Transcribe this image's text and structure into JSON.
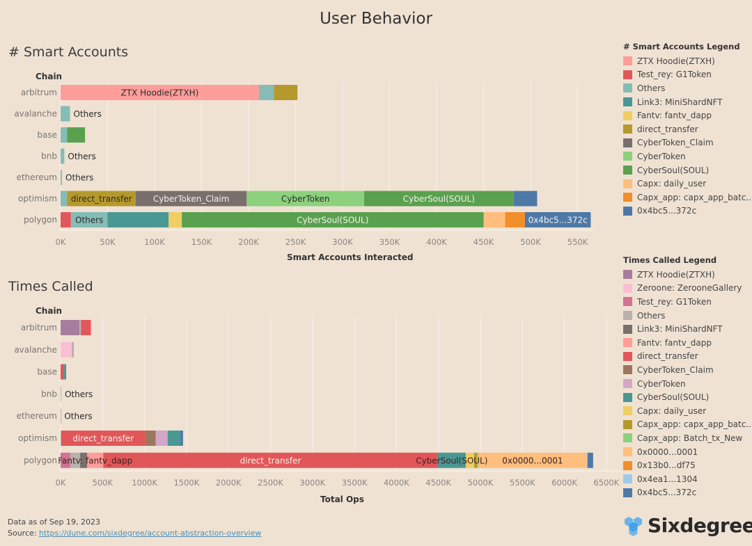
{
  "title": "User Behavior",
  "sections": {
    "smart_accounts_title": "# Smart Accounts",
    "times_called_title": "Times Called"
  },
  "chart_data": [
    {
      "type": "bar",
      "orientation": "horizontal-stacked",
      "title": "# Smart Accounts",
      "row_header": "Chain",
      "xlabel": "Smart Accounts Interacted",
      "ylabel": "Chain",
      "xlim": [
        0,
        560
      ],
      "unit": "K",
      "grid": true,
      "ticks": [
        "0K",
        "50K",
        "100K",
        "150K",
        "200K",
        "250K",
        "300K",
        "350K",
        "400K",
        "450K",
        "500K",
        "550K"
      ],
      "tick_values": [
        0,
        50,
        100,
        150,
        200,
        250,
        300,
        350,
        400,
        450,
        500,
        550
      ],
      "categories": [
        "arbitrum",
        "avalanche",
        "base",
        "bnb",
        "ethereum",
        "optimism",
        "polygon"
      ],
      "rows": [
        {
          "chain": "arbitrum",
          "segments": [
            {
              "name": "ZTX Hoodie(ZTXH)",
              "value": 211,
              "label": "ZTX Hoodie(ZTXH)"
            },
            {
              "name": "Others",
              "value": 16
            },
            {
              "name": "direct_transfer",
              "value": 25
            }
          ]
        },
        {
          "chain": "avalanche",
          "outside_label": "Others",
          "segments": [
            {
              "name": "Others",
              "value": 10
            }
          ]
        },
        {
          "chain": "base",
          "segments": [
            {
              "name": "Others",
              "value": 7
            },
            {
              "name": "CyberSoul(SOUL)",
              "value": 19
            }
          ]
        },
        {
          "chain": "bnb",
          "outside_label": "Others",
          "segments": [
            {
              "name": "Others",
              "value": 4
            }
          ]
        },
        {
          "chain": "ethereum",
          "outside_label": "Others",
          "segments": [
            {
              "name": "Others",
              "value": 1.5
            }
          ]
        },
        {
          "chain": "optimism",
          "segments": [
            {
              "name": "Others",
              "value": 7
            },
            {
              "name": "direct_transfer",
              "value": 73,
              "label": "direct_transfer"
            },
            {
              "name": "CyberToken_Claim",
              "value": 118,
              "label": "CyberToken_Claim"
            },
            {
              "name": "CyberToken",
              "value": 125,
              "label": "CyberToken"
            },
            {
              "name": "CyberSoul(SOUL)",
              "value": 159,
              "label": "CyberSoul(SOUL)"
            },
            {
              "name": "0x4bc5...372c",
              "value": 25
            }
          ]
        },
        {
          "chain": "polygon",
          "segments": [
            {
              "name": "Test_rey: G1Token",
              "value": 11
            },
            {
              "name": "Others",
              "value": 39,
              "label": "Others"
            },
            {
              "name": "Link3: MiniShardNFT",
              "value": 65
            },
            {
              "name": "Fantv: fantv_dapp",
              "value": 14
            },
            {
              "name": "CyberSoul(SOUL)",
              "value": 321,
              "label": "CyberSoul(SOUL)"
            },
            {
              "name": "Capx: daily_user",
              "value": 23
            },
            {
              "name": "Capx_app: capx_app_batc..",
              "value": 21
            },
            {
              "name": "0x4bc5...372c",
              "value": 70,
              "label": "0x4bc5...372c"
            }
          ]
        }
      ],
      "legend": {
        "title": "# Smart Accounts Legend",
        "placement": "right",
        "items": [
          {
            "name": "ZTX Hoodie(ZTXH)",
            "color": "#ff9d9a"
          },
          {
            "name": "Test_rey: G1Token",
            "color": "#e15759"
          },
          {
            "name": "Others",
            "color": "#86bcb6"
          },
          {
            "name": "Link3: MiniShardNFT",
            "color": "#499894"
          },
          {
            "name": "Fantv: fantv_dapp",
            "color": "#f1ce63"
          },
          {
            "name": "direct_transfer",
            "color": "#b6992d"
          },
          {
            "name": "CyberToken_Claim",
            "color": "#79706e"
          },
          {
            "name": "CyberToken",
            "color": "#8cd17d"
          },
          {
            "name": "CyberSoul(SOUL)",
            "color": "#59a14f"
          },
          {
            "name": "Capx: daily_user",
            "color": "#ffbe7d"
          },
          {
            "name": "Capx_app: capx_app_batc..",
            "color": "#f28e2b"
          },
          {
            "name": "0x4bc5...372c",
            "color": "#4e79a7"
          }
        ]
      }
    },
    {
      "type": "bar",
      "orientation": "horizontal-stacked",
      "title": "Times Called",
      "row_header": "Chain",
      "xlabel": "Total Ops",
      "ylabel": "Chain",
      "xlim": [
        0,
        6600
      ],
      "unit": "K",
      "grid": true,
      "ticks": [
        "0K",
        "500K",
        "1000K",
        "1500K",
        "2000K",
        "2500K",
        "3000K",
        "3500K",
        "4000K",
        "4500K",
        "5000K",
        "5500K",
        "6000K",
        "6500K"
      ],
      "tick_values": [
        0,
        500,
        1000,
        1500,
        2000,
        2500,
        3000,
        3500,
        4000,
        4500,
        5000,
        5500,
        6000,
        6500
      ],
      "categories": [
        "arbitrum",
        "avalanche",
        "base",
        "bnb",
        "ethereum",
        "optimism",
        "polygon"
      ],
      "rows": [
        {
          "chain": "arbitrum",
          "segments": [
            {
              "name": "ZTX Hoodie(ZTXH)",
              "value": 225
            },
            {
              "name": "Others",
              "value": 17
            },
            {
              "name": "direct_transfer",
              "value": 117
            },
            {
              "name": "Fantv: fantv_dapp",
              "value": 8
            }
          ]
        },
        {
          "chain": "avalanche",
          "segments": [
            {
              "name": "Zeroone: ZerooneGallery",
              "value": 133
            },
            {
              "name": "Others",
              "value": 25
            }
          ]
        },
        {
          "chain": "base",
          "segments": [
            {
              "name": "direct_transfer",
              "value": 42
            },
            {
              "name": "CyberSoul(SOUL)",
              "value": 25
            }
          ]
        },
        {
          "chain": "bnb",
          "outside_label": "Others",
          "segments": [
            {
              "name": "Others",
              "value": 8
            }
          ]
        },
        {
          "chain": "ethereum",
          "outside_label": "Others",
          "segments": [
            {
              "name": "Others",
              "value": 3
            }
          ]
        },
        {
          "chain": "optimism",
          "segments": [
            {
              "name": "Others",
              "value": 8
            },
            {
              "name": "direct_transfer",
              "value": 1000,
              "label": "direct_transfer"
            },
            {
              "name": "CyberToken_Claim",
              "value": 125
            },
            {
              "name": "CyberToken",
              "value": 142
            },
            {
              "name": "CyberSoul(SOUL)",
              "value": 150
            },
            {
              "name": "0x4bc5...372c",
              "value": 33
            }
          ]
        },
        {
          "chain": "polygon",
          "segments": [
            {
              "name": "Test_rey: G1Token",
              "value": 117
            },
            {
              "name": "Others",
              "value": 116
            },
            {
              "name": "Link3: MiniShardNFT",
              "value": 84
            },
            {
              "name": "Fantv: fantv_dapp",
              "value": 191,
              "label": "Fantv: fantv_dapp",
              "label_dark": true
            },
            {
              "name": "direct_transfer",
              "value": 3984,
              "label": "direct_transfer"
            },
            {
              "name": "CyberSoul(SOUL)",
              "value": 333,
              "label": "CyberSoul(SOUL)",
              "label_dark": true
            },
            {
              "name": "Capx: daily_user",
              "value": 100
            },
            {
              "name": "Capx_app: capx_app_batc..",
              "value": 33
            },
            {
              "name": "Capx_app: Batch_tx_New",
              "value": 17
            },
            {
              "name": "0x0000...0001",
              "value": 1292,
              "label": "0x0000...0001",
              "label_dark": true
            },
            {
              "name": "0x4ea1...1304",
              "value": 8
            },
            {
              "name": "0x4bc5...372c",
              "value": 67
            }
          ]
        }
      ],
      "legend": {
        "title": "Times Called Legend",
        "placement": "right",
        "items": [
          {
            "name": "ZTX Hoodie(ZTXH)",
            "color": "#a87c9f"
          },
          {
            "name": "Zeroone: ZerooneGallery",
            "color": "#fabfd2"
          },
          {
            "name": "Test_rey: G1Token",
            "color": "#d37295"
          },
          {
            "name": "Others",
            "color": "#bab0ac"
          },
          {
            "name": "Link3: MiniShardNFT",
            "color": "#79706e"
          },
          {
            "name": "Fantv: fantv_dapp",
            "color": "#ff9d9a"
          },
          {
            "name": "direct_transfer",
            "color": "#e15759"
          },
          {
            "name": "CyberToken_Claim",
            "color": "#9d7660"
          },
          {
            "name": "CyberToken",
            "color": "#d4a6c8"
          },
          {
            "name": "CyberSoul(SOUL)",
            "color": "#499894"
          },
          {
            "name": "Capx: daily_user",
            "color": "#f1ce63"
          },
          {
            "name": "Capx_app: capx_app_batc..",
            "color": "#b6992d"
          },
          {
            "name": "Capx_app: Batch_tx_New",
            "color": "#8cd17d"
          },
          {
            "name": "0x0000...0001",
            "color": "#ffbe7d"
          },
          {
            "name": "0x13b0...df75",
            "color": "#f28e2b"
          },
          {
            "name": "0x4ea1...1304",
            "color": "#a0cbe8"
          },
          {
            "name": "0x4bc5...372c",
            "color": "#4e79a7"
          }
        ]
      }
    }
  ],
  "footer": {
    "data_as_of": "Data as of  Sep 19, 2023",
    "source_label": "Source: ",
    "source_link": "https://dune.com/sixdegree/account-abstraction-overview"
  },
  "brand": {
    "name": "Sixdegree",
    "icon": "hexagon-cluster-icon",
    "color": "#3ea6ef"
  }
}
